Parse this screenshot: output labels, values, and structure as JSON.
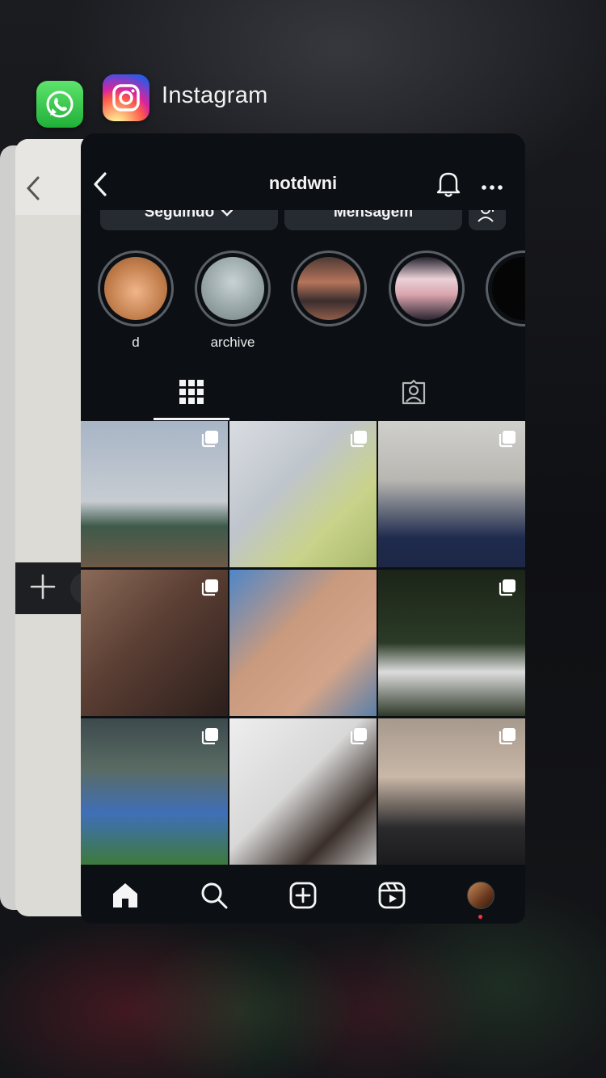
{
  "switcher": {
    "app_name": "Instagram",
    "icons": {
      "whatsapp": "whatsapp-app-icon",
      "instagram": "instagram-app-icon"
    }
  },
  "instagram": {
    "username": "notdwni",
    "buttons": {
      "following": "Seguindo",
      "message": "Mensagem"
    },
    "highlights": [
      {
        "label": "d"
      },
      {
        "label": "archive"
      },
      {
        "label": ""
      },
      {
        "label": ""
      },
      {
        "label": ""
      }
    ],
    "tabs": [
      "grid-icon",
      "tagged-icon"
    ],
    "nav": [
      "home-icon",
      "search-icon",
      "create-icon",
      "reels-icon",
      "profile-avatar"
    ]
  },
  "colors": {
    "ig_bg": "#0c1014",
    "button_bg": "#262b32",
    "notification_dot": "#ff3040"
  }
}
